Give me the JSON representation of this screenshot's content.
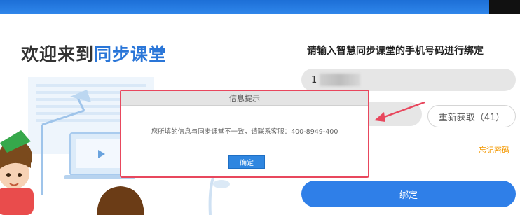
{
  "welcome": {
    "part1": "欢迎来到",
    "part2": "同步课堂"
  },
  "form": {
    "title": "请输入智慧同步课堂的手机号码进行绑定",
    "phone_value": "1",
    "resend_label": "重新获取（41）",
    "forgot_label": "忘记密码",
    "bind_label": "绑定"
  },
  "dialog": {
    "title": "信息提示",
    "message": "您所填的信息与同步课堂不一致，请联系客服：400-8949-400",
    "ok_label": "确定"
  },
  "colors": {
    "brand_blue": "#2f7fe8",
    "alert_red": "#e8475d",
    "forgot_orange": "#f39800"
  }
}
